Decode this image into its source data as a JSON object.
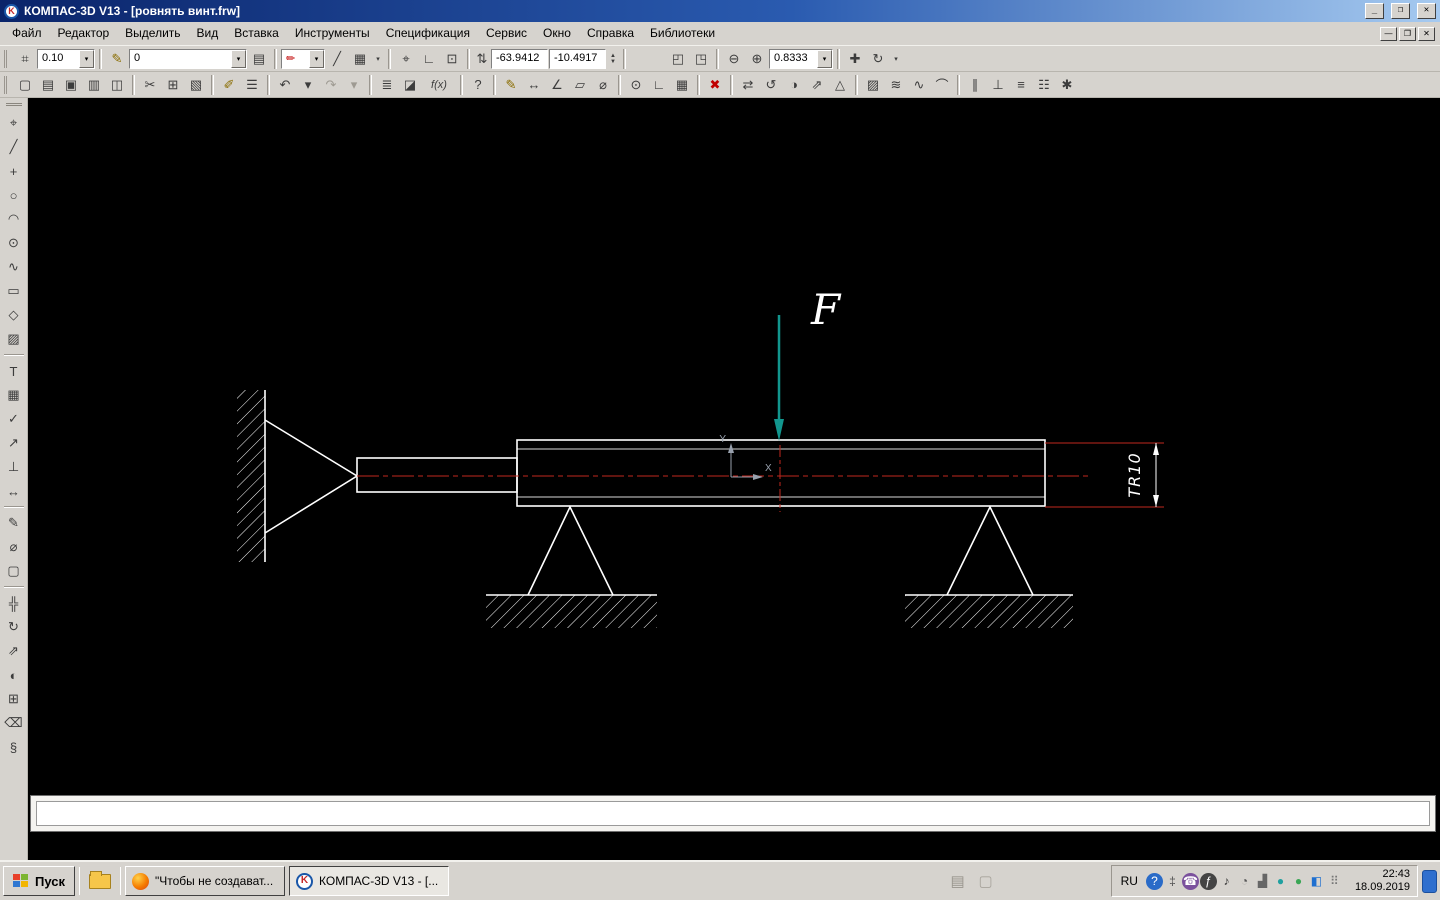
{
  "titlebar": {
    "title": "КОМПАС-3D V13 - [ровнять винт.frw]",
    "app_letter": "K",
    "minimize_glyph": "_",
    "restore_glyph": "❐",
    "close_glyph": "✕"
  },
  "menubar": {
    "items": [
      {
        "name": "menu-file",
        "label": "Файл"
      },
      {
        "name": "menu-editor",
        "label": "Редактор"
      },
      {
        "name": "menu-select",
        "label": "Выделить"
      },
      {
        "name": "menu-view",
        "label": "Вид"
      },
      {
        "name": "menu-insert",
        "label": "Вставка"
      },
      {
        "name": "menu-tools",
        "label": "Инструменты"
      },
      {
        "name": "menu-specification",
        "label": "Спецификация"
      },
      {
        "name": "menu-service",
        "label": "Сервис"
      },
      {
        "name": "menu-window",
        "label": "Окно"
      },
      {
        "name": "menu-help",
        "label": "Справка"
      },
      {
        "name": "menu-libraries",
        "label": "Библиотеки"
      }
    ],
    "mdi_minimize": "—",
    "mdi_restore": "❐",
    "mdi_close": "✕"
  },
  "toolbar1": {
    "cursor_step_icon": "⌗",
    "step_value": "0.10",
    "layer_icon": "✎",
    "layer_value": "0",
    "layers_button_icon": "▤",
    "line_style_icon": "✏",
    "angle_icon": "╱",
    "grid_icon": "▦",
    "axes_icon": "⌖",
    "ortho_icon": "∟",
    "snap_icon": "⊡",
    "coord_icon": "⇅",
    "x_value": "-63.9412",
    "y_value": "-10.4917",
    "zoom_frame_icon": "◰",
    "zoom_page_icon": "◳",
    "zoom_out_icon": "⊖",
    "zoom_in_icon": "⊕",
    "zoom_value": "0.8333",
    "pan_icon": "✚",
    "refresh_icon": "↻",
    "dropdown_arrow": "▾",
    "spinner_up": "▲",
    "spinner_down": "▼"
  },
  "toolbar2": {
    "icons": [
      {
        "name": "new-document-icon",
        "glyph": "▢"
      },
      {
        "name": "open-document-icon",
        "glyph": "▤"
      },
      {
        "name": "save-icon",
        "glyph": "▣"
      },
      {
        "name": "print-icon",
        "glyph": "▥"
      },
      {
        "name": "print-preview-icon",
        "glyph": "◫"
      },
      {
        "sep": true
      },
      {
        "name": "cut-icon",
        "glyph": "✂"
      },
      {
        "name": "copy-icon",
        "glyph": "⊞"
      },
      {
        "name": "paste-icon",
        "glyph": "▧"
      },
      {
        "sep": true
      },
      {
        "name": "copy-properties-icon",
        "glyph": "✐",
        "color": "#8a6d00"
      },
      {
        "name": "specification-icon",
        "glyph": "☰"
      },
      {
        "sep": true
      },
      {
        "name": "undo-icon",
        "glyph": "↶"
      },
      {
        "name": "undo-dropdown-icon",
        "glyph": "▾"
      },
      {
        "name": "redo-icon",
        "glyph": "↷",
        "color": "#9e9a92"
      },
      {
        "name": "redo-dropdown-icon",
        "glyph": "▾",
        "color": "#9e9a92"
      },
      {
        "sep": true
      },
      {
        "name": "calculator-icon",
        "glyph": "≣"
      },
      {
        "name": "document-manager-icon",
        "glyph": "◪"
      },
      {
        "name": "fx-icon",
        "glyph": "f(x)",
        "wide": true
      },
      {
        "sep": true
      },
      {
        "name": "context-help-icon",
        "glyph": "?"
      },
      {
        "sep": true
      },
      {
        "name": "sketch-pencil-icon",
        "glyph": "✎",
        "color": "#8a6d00"
      },
      {
        "name": "measure-length-icon",
        "glyph": "↔"
      },
      {
        "name": "measure-angle-icon",
        "glyph": "∠"
      },
      {
        "name": "area-icon",
        "glyph": "▱"
      },
      {
        "name": "diameter-icon",
        "glyph": "⌀"
      },
      {
        "sep": true
      },
      {
        "name": "snap-settings-icon",
        "glyph": "⊙"
      },
      {
        "name": "right-angle-icon",
        "glyph": "∟"
      },
      {
        "name": "grid-snap-icon",
        "glyph": "▦"
      },
      {
        "sep": true
      },
      {
        "name": "delete-object-icon",
        "glyph": "✖",
        "color": "#c00000"
      },
      {
        "sep": true
      },
      {
        "name": "move-object-icon",
        "glyph": "⇄"
      },
      {
        "name": "rotate-object-icon",
        "glyph": "↺"
      },
      {
        "name": "mirror-object-icon",
        "glyph": "◑"
      },
      {
        "name": "scale-object-icon",
        "glyph": "⇗"
      },
      {
        "name": "deform-object-icon",
        "glyph": "△"
      },
      {
        "sep": true
      },
      {
        "name": "hatch-tool-icon",
        "glyph": "▨"
      },
      {
        "name": "equidistant-icon",
        "glyph": "≋"
      },
      {
        "name": "spline-edit-icon",
        "glyph": "∿"
      },
      {
        "name": "arc-edit-icon",
        "glyph": "⌒"
      },
      {
        "sep": true
      },
      {
        "name": "parallel-icon",
        "glyph": "∥"
      },
      {
        "name": "perpendicular-icon",
        "glyph": "⊥"
      },
      {
        "name": "align-icon",
        "glyph": "≡"
      },
      {
        "name": "layers-icon",
        "glyph": "☷"
      },
      {
        "name": "options-icon",
        "glyph": "✱"
      }
    ]
  },
  "left_toolbar": {
    "icons": [
      {
        "name": "select-tool-icon",
        "glyph": "⌖"
      },
      {
        "name": "line-tool-icon",
        "glyph": "╱"
      },
      {
        "name": "point-tool-icon",
        "glyph": "+"
      },
      {
        "name": "circle-tool-icon",
        "glyph": "○"
      },
      {
        "name": "arc-tool-icon",
        "glyph": "◠"
      },
      {
        "name": "ellipse-tool-icon",
        "glyph": "⊙"
      },
      {
        "name": "spline-tool-icon",
        "glyph": "∿"
      },
      {
        "name": "rectangle-tool-icon",
        "glyph": "▭"
      },
      {
        "name": "polygon-tool-icon",
        "glyph": "◇"
      },
      {
        "name": "hatch-region-icon",
        "glyph": "▨"
      },
      {
        "sep": true
      },
      {
        "name": "text-tool-icon",
        "glyph": "T"
      },
      {
        "name": "table-tool-icon",
        "glyph": "▦"
      },
      {
        "name": "roughness-tool-icon",
        "glyph": "✓"
      },
      {
        "name": "leader-tool-icon",
        "glyph": "↗"
      },
      {
        "name": "datum-tool-icon",
        "glyph": "⊥"
      },
      {
        "name": "dimension-tool-icon",
        "glyph": "↔"
      },
      {
        "sep": true
      },
      {
        "name": "modify-tool-icon",
        "glyph": "✎"
      },
      {
        "name": "measure-tool-icon",
        "glyph": "⌀"
      },
      {
        "name": "select-frame-icon",
        "glyph": "▢"
      },
      {
        "sep": true
      },
      {
        "name": "move-tool-icon",
        "glyph": "╬"
      },
      {
        "name": "rotate-tool-icon",
        "glyph": "↻"
      },
      {
        "name": "scale-tool-icon",
        "glyph": "⇗"
      },
      {
        "name": "mirror-tool-icon",
        "glyph": "◐"
      },
      {
        "name": "copy-tool-icon",
        "glyph": "⊞"
      },
      {
        "name": "erase-tool-icon",
        "glyph": "⌫"
      },
      {
        "name": "macros-tool-icon",
        "glyph": "§"
      }
    ]
  },
  "drawing": {
    "force_label": "F",
    "dimension_label": "TR10",
    "axis_x": "X",
    "axis_y": "Y",
    "colors": {
      "force": "#12968e",
      "centerline": "#c0281e",
      "lines": "#ffffff"
    }
  },
  "property_bar": {
    "value": ""
  },
  "taskbar": {
    "start_label": "Пуск",
    "tasks": [
      {
        "label": "\"Чтобы не создават...",
        "app": "firefox"
      },
      {
        "label": "КОМПАС-3D V13 - [...",
        "app": "kompas"
      }
    ],
    "mid_icons": [
      {
        "name": "taskbar-doc-icon",
        "glyph": "▤",
        "color": "#98948c"
      },
      {
        "name": "taskbar-page-icon",
        "glyph": "▢",
        "color": "#a8a49c"
      }
    ],
    "tray": {
      "lang": "RU",
      "icons": [
        {
          "name": "tray-help-icon",
          "glyph": "?",
          "bg": "#2a6bc8",
          "color": "#ffffff"
        },
        {
          "name": "tray-updates-icon",
          "glyph": "‡",
          "color": "#555555"
        },
        {
          "name": "tray-viber-icon",
          "glyph": "☎",
          "bg": "#7b519d",
          "color": "#ffffff"
        },
        {
          "name": "tray-switcher-icon",
          "glyph": "ƒ",
          "bg": "#444444",
          "color": "#ffffff"
        },
        {
          "name": "tray-volume-icon",
          "glyph": "♪",
          "color": "#333333"
        },
        {
          "name": "tray-meter-icon",
          "glyph": "◔",
          "color": "#555555"
        },
        {
          "name": "tray-network-icon",
          "glyph": "▟",
          "color": "#666666"
        },
        {
          "name": "tray-cloud-icon",
          "glyph": "●",
          "color": "#1fa0a0"
        },
        {
          "name": "tray-antivirus-icon",
          "glyph": "●",
          "color": "#3aa655"
        },
        {
          "name": "tray-browser-icon",
          "glyph": "◧",
          "color": "#1e6fd0"
        },
        {
          "name": "tray-apps-icon",
          "glyph": "⠿",
          "color": "#777777"
        }
      ],
      "time": "22:43",
      "date": "18.09.2019"
    }
  }
}
